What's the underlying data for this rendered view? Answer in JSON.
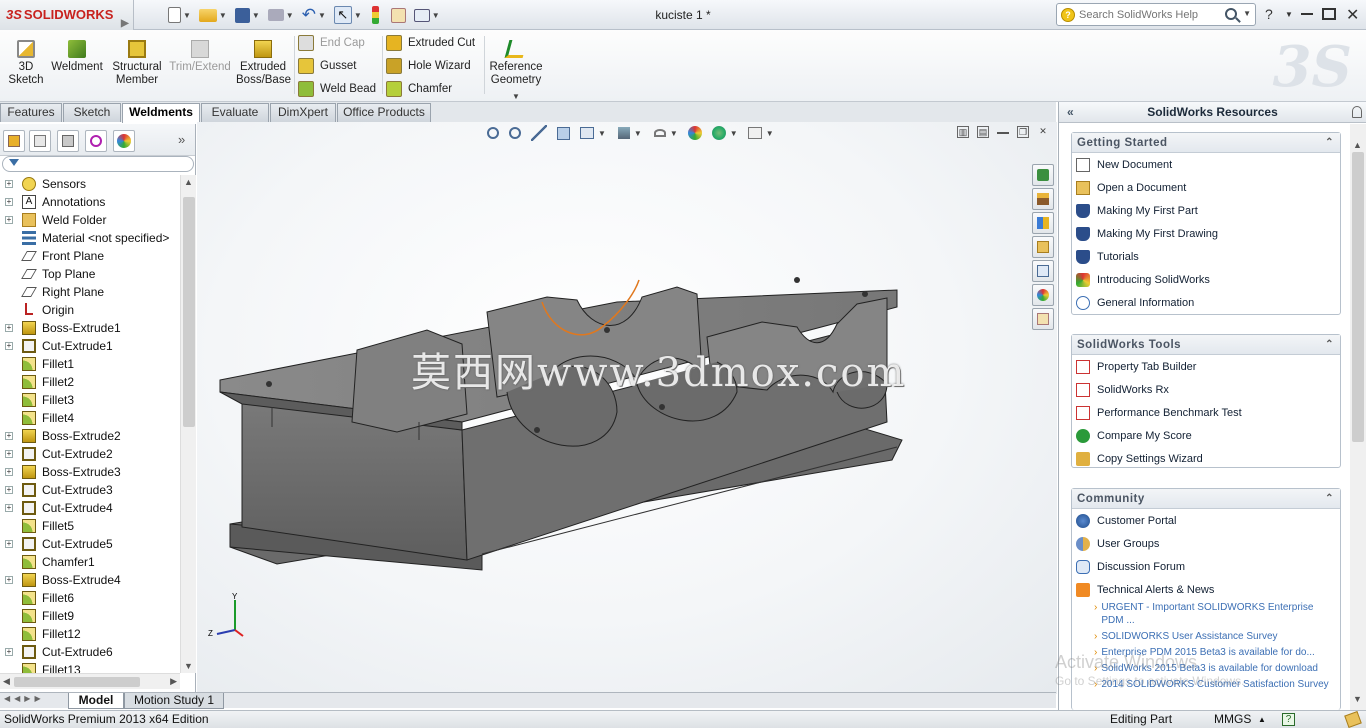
{
  "app": {
    "brand": "SOLIDWORKS",
    "brand_mark": "3S",
    "document_title": "kuciste 1 *",
    "search_placeholder": "Search SolidWorks Help",
    "help_glyph": "?"
  },
  "ribbon": {
    "big_buttons": [
      {
        "label": "3D\nSketch",
        "icon": "3d-sketch-icon",
        "enabled": true
      },
      {
        "label": "Weldment",
        "icon": "weldment-icon",
        "enabled": true
      },
      {
        "label": "Structural\nMember",
        "icon": "structural-member-icon",
        "enabled": true
      },
      {
        "label": "Trim/Extend",
        "icon": "trim-extend-icon",
        "enabled": false
      },
      {
        "label": "Extruded\nBoss/Base",
        "icon": "extruded-boss-icon",
        "enabled": true
      }
    ],
    "col1": [
      {
        "label": "End Cap",
        "icon": "end-cap-icon",
        "enabled": false
      },
      {
        "label": "Gusset",
        "icon": "gusset-icon",
        "enabled": true
      },
      {
        "label": "Weld Bead",
        "icon": "weld-bead-icon",
        "enabled": true
      }
    ],
    "col2": [
      {
        "label": "Extruded Cut",
        "icon": "extruded-cut-icon",
        "enabled": true
      },
      {
        "label": "Hole Wizard",
        "icon": "hole-wizard-icon",
        "enabled": true
      },
      {
        "label": "Chamfer",
        "icon": "chamfer-icon",
        "enabled": true
      }
    ],
    "reference": {
      "label": "Reference\nGeometry",
      "icon": "reference-geometry-icon"
    }
  },
  "tabs": [
    "Features",
    "Sketch",
    "Weldments",
    "Evaluate",
    "DimXpert",
    "Office Products"
  ],
  "active_tab": "Weldments",
  "tree": [
    {
      "label": "Sensors",
      "icon": "sensors",
      "expand": true
    },
    {
      "label": "Annotations",
      "icon": "annotations",
      "expand": true
    },
    {
      "label": "Weld Folder",
      "icon": "folder",
      "expand": true
    },
    {
      "label": "Material <not specified>",
      "icon": "material",
      "expand": false
    },
    {
      "label": "Front Plane",
      "icon": "plane",
      "expand": false
    },
    {
      "label": "Top Plane",
      "icon": "plane",
      "expand": false
    },
    {
      "label": "Right Plane",
      "icon": "plane",
      "expand": false
    },
    {
      "label": "Origin",
      "icon": "origin",
      "expand": false
    },
    {
      "label": "Boss-Extrude1",
      "icon": "extrude",
      "expand": true
    },
    {
      "label": "Cut-Extrude1",
      "icon": "cut",
      "expand": true
    },
    {
      "label": "Fillet1",
      "icon": "fillet",
      "expand": false
    },
    {
      "label": "Fillet2",
      "icon": "fillet",
      "expand": false
    },
    {
      "label": "Fillet3",
      "icon": "fillet",
      "expand": false
    },
    {
      "label": "Fillet4",
      "icon": "fillet",
      "expand": false
    },
    {
      "label": "Boss-Extrude2",
      "icon": "extrude",
      "expand": true
    },
    {
      "label": "Cut-Extrude2",
      "icon": "cut",
      "expand": true
    },
    {
      "label": "Boss-Extrude3",
      "icon": "extrude",
      "expand": true
    },
    {
      "label": "Cut-Extrude3",
      "icon": "cut",
      "expand": true
    },
    {
      "label": "Cut-Extrude4",
      "icon": "cut",
      "expand": true
    },
    {
      "label": "Fillet5",
      "icon": "fillet",
      "expand": false
    },
    {
      "label": "Cut-Extrude5",
      "icon": "cut",
      "expand": true
    },
    {
      "label": "Chamfer1",
      "icon": "fillet",
      "expand": false
    },
    {
      "label": "Boss-Extrude4",
      "icon": "extrude",
      "expand": true
    },
    {
      "label": "Fillet6",
      "icon": "fillet",
      "expand": false
    },
    {
      "label": "Fillet9",
      "icon": "fillet",
      "expand": false
    },
    {
      "label": "Fillet12",
      "icon": "fillet",
      "expand": false
    },
    {
      "label": "Cut-Extrude6",
      "icon": "cut",
      "expand": true
    },
    {
      "label": "Fillet13",
      "icon": "fillet",
      "expand": false
    }
  ],
  "viewport": {
    "watermark": "莫西网www.3dmox.com",
    "triad_labels": {
      "y": "Y",
      "z": "Z"
    }
  },
  "bottom_tabs": [
    "Model",
    "Motion Study 1"
  ],
  "active_bottom_tab": "Model",
  "status": {
    "edition": "SolidWorks Premium 2013 x64 Edition",
    "mode": "Editing Part",
    "units": "MMGS",
    "help_glyph": "?"
  },
  "resources": {
    "title": "SolidWorks Resources",
    "getting_started": {
      "title": "Getting Started",
      "items": [
        "New Document",
        "Open a Document",
        "Making My First Part",
        "Making My First Drawing",
        "Tutorials",
        "Introducing SolidWorks",
        "General Information"
      ]
    },
    "tools": {
      "title": "SolidWorks Tools",
      "items": [
        "Property Tab Builder",
        "SolidWorks Rx",
        "Performance Benchmark Test",
        "Compare My Score",
        "Copy Settings Wizard"
      ]
    },
    "community": {
      "title": "Community",
      "items": [
        "Customer Portal",
        "User Groups",
        "Discussion Forum",
        "Technical Alerts & News"
      ],
      "news": [
        "URGENT - Important SOLIDWORKS Enterprise PDM ...",
        "SOLIDWORKS User Assistance Survey",
        "Enterprise PDM 2015 Beta3 is available for do...",
        "SolidWorks 2015 Beta3 is available for download",
        "2014 SOLIDWORKS Customer Satisfaction Survey"
      ]
    }
  },
  "os_overlay": {
    "title": "Activate Windows",
    "subtitle": "Go to Settings to activate Windows."
  },
  "colors": {
    "accent": "#c8221e",
    "part_gray": "#6e6e6e",
    "link_blue": "#3c6fb4"
  }
}
